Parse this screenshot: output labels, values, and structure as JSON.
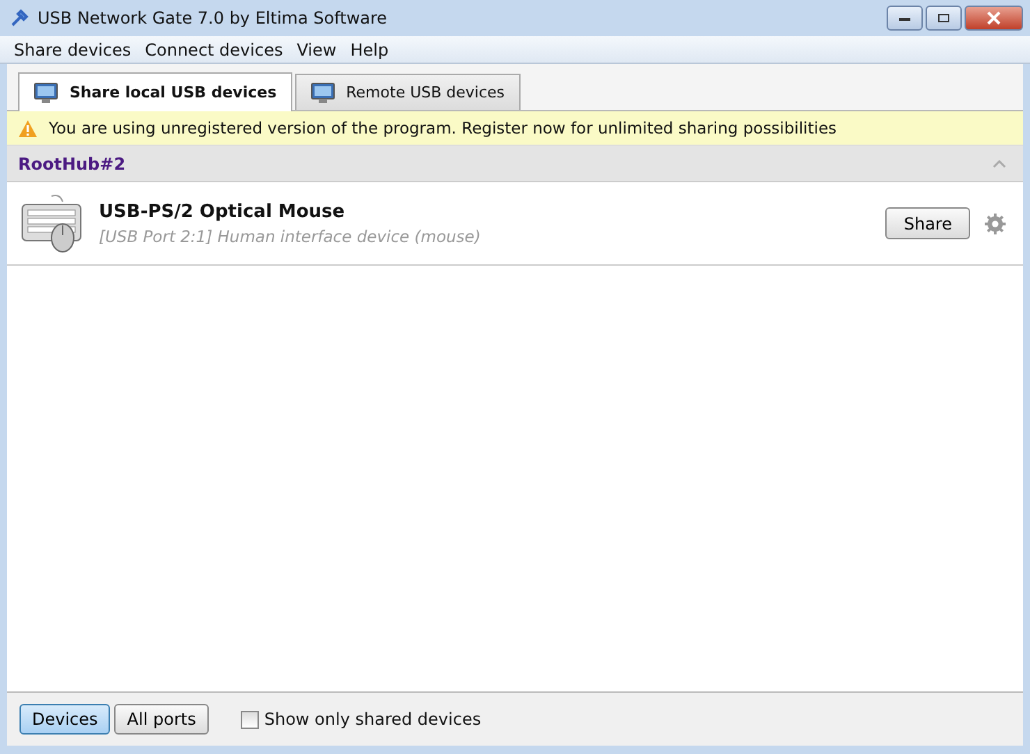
{
  "window": {
    "title": "USB Network Gate 7.0 by Eltima Software"
  },
  "menu": [
    "Share devices",
    "Connect devices",
    "View",
    "Help"
  ],
  "tabs": [
    {
      "label": "Share local USB devices",
      "selected": true
    },
    {
      "label": "Remote USB devices",
      "selected": false
    }
  ],
  "warning": "You are using unregistered version of the program. Register now for unlimited sharing possibilities",
  "hub": {
    "name": "RootHub#2",
    "expanded": true,
    "devices": [
      {
        "name": "USB-PS/2 Optical Mouse",
        "detail": "[USB Port 2:1] Human interface device (mouse)",
        "action": "Share"
      }
    ]
  },
  "view_buttons": [
    {
      "label": "Devices",
      "selected": true
    },
    {
      "label": "All ports",
      "selected": false
    }
  ],
  "show_only_shared": {
    "label": "Show only shared devices",
    "checked": false
  }
}
